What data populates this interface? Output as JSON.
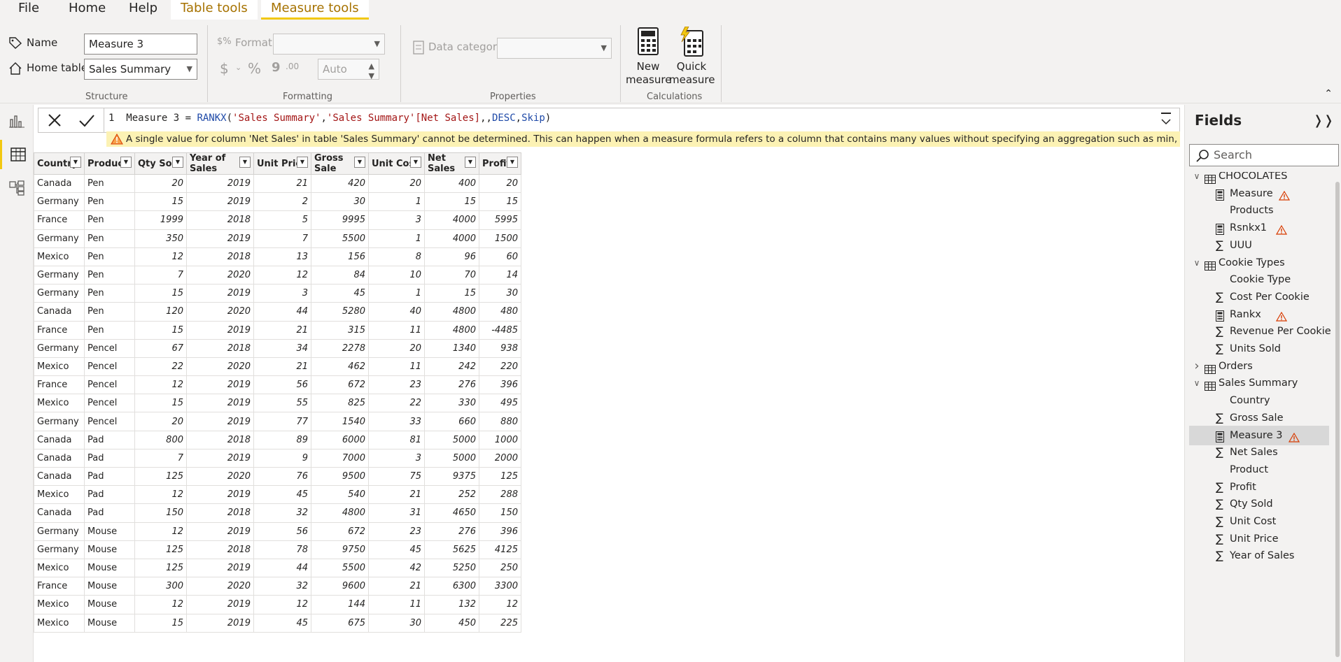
{
  "menu": {
    "file": "File",
    "home": "Home",
    "help": "Help",
    "table_tools": "Table tools",
    "measure_tools": "Measure tools"
  },
  "structure": {
    "group_label": "Structure",
    "name_label": "Name",
    "name_value": "Measure 3",
    "home_table_label": "Home table",
    "home_table_value": "Sales Summary"
  },
  "formatting": {
    "group_label": "Formatting",
    "format_label": "Format",
    "format_value": "",
    "auto_value": "Auto",
    "comma_symbol": "9",
    "decimal_symbol": ".00"
  },
  "properties": {
    "group_label": "Properties",
    "data_category_label": "Data category",
    "data_category_value": ""
  },
  "calculations": {
    "group_label": "Calculations",
    "new_measure": "New measure",
    "quick_measure": "Quick measure"
  },
  "formula": {
    "line_no": "1",
    "lead": "Measure 3 = ",
    "fn": "RANKX",
    "open": "(",
    "arg1": "'Sales Summary'",
    "comma1": ",",
    "arg2": "'Sales Summary'[Net Sales]",
    "commas": ",,",
    "kw1": "DESC",
    "comma2": ",",
    "kw2": "Skip",
    "close": ")",
    "error": "A single value for column 'Net Sales' in table 'Sales Summary' cannot be determined. This can happen when a measure formula refers to a column that contains many values without specifying an aggregation such as min, max, count, or sum to get a single result."
  },
  "table": {
    "columns": [
      "Country",
      "Product",
      "Qty Sold",
      "Year of Sales",
      "Unit Price",
      "Gross Sale",
      "Unit Cost",
      "Net Sales",
      "Profit"
    ],
    "rows": [
      [
        "Canada",
        "Pen",
        "20",
        "2019",
        "21",
        "420",
        "20",
        "400",
        "20"
      ],
      [
        "Germany",
        "Pen",
        "15",
        "2019",
        "2",
        "30",
        "1",
        "15",
        "15"
      ],
      [
        "France",
        "Pen",
        "1999",
        "2018",
        "5",
        "9995",
        "3",
        "4000",
        "5995"
      ],
      [
        "Germany",
        "Pen",
        "350",
        "2019",
        "7",
        "5500",
        "1",
        "4000",
        "1500"
      ],
      [
        "Mexico",
        "Pen",
        "12",
        "2018",
        "13",
        "156",
        "8",
        "96",
        "60"
      ],
      [
        "Germany",
        "Pen",
        "7",
        "2020",
        "12",
        "84",
        "10",
        "70",
        "14"
      ],
      [
        "Germany",
        "Pen",
        "15",
        "2019",
        "3",
        "45",
        "1",
        "15",
        "30"
      ],
      [
        "Canada",
        "Pen",
        "120",
        "2020",
        "44",
        "5280",
        "40",
        "4800",
        "480"
      ],
      [
        "France",
        "Pen",
        "15",
        "2019",
        "21",
        "315",
        "11",
        "4800",
        "-4485"
      ],
      [
        "Germany",
        "Pencel",
        "67",
        "2018",
        "34",
        "2278",
        "20",
        "1340",
        "938"
      ],
      [
        "Mexico",
        "Pencel",
        "22",
        "2020",
        "21",
        "462",
        "11",
        "242",
        "220"
      ],
      [
        "France",
        "Pencel",
        "12",
        "2019",
        "56",
        "672",
        "23",
        "276",
        "396"
      ],
      [
        "Mexico",
        "Pencel",
        "15",
        "2019",
        "55",
        "825",
        "22",
        "330",
        "495"
      ],
      [
        "Germany",
        "Pencel",
        "20",
        "2019",
        "77",
        "1540",
        "33",
        "660",
        "880"
      ],
      [
        "Canada",
        "Pad",
        "800",
        "2018",
        "89",
        "6000",
        "81",
        "5000",
        "1000"
      ],
      [
        "Canada",
        "Pad",
        "7",
        "2019",
        "9",
        "7000",
        "3",
        "5000",
        "2000"
      ],
      [
        "Canada",
        "Pad",
        "125",
        "2020",
        "76",
        "9500",
        "75",
        "9375",
        "125"
      ],
      [
        "Mexico",
        "Pad",
        "12",
        "2019",
        "45",
        "540",
        "21",
        "252",
        "288"
      ],
      [
        "Canada",
        "Pad",
        "150",
        "2018",
        "32",
        "4800",
        "31",
        "4650",
        "150"
      ],
      [
        "Germany",
        "Mouse",
        "12",
        "2019",
        "56",
        "672",
        "23",
        "276",
        "396"
      ],
      [
        "Germany",
        "Mouse",
        "125",
        "2018",
        "78",
        "9750",
        "45",
        "5625",
        "4125"
      ],
      [
        "Mexico",
        "Mouse",
        "125",
        "2019",
        "44",
        "5500",
        "42",
        "5250",
        "250"
      ],
      [
        "France",
        "Mouse",
        "300",
        "2020",
        "32",
        "9600",
        "21",
        "6300",
        "3300"
      ],
      [
        "Mexico",
        "Mouse",
        "12",
        "2019",
        "12",
        "144",
        "11",
        "132",
        "12"
      ],
      [
        "Mexico",
        "Mouse",
        "15",
        "2019",
        "45",
        "675",
        "30",
        "450",
        "225"
      ]
    ]
  },
  "fields": {
    "title": "Fields",
    "search_placeholder": "Search",
    "items": [
      {
        "kind": "table",
        "label": "CHOCOLATES",
        "expanded": true
      },
      {
        "kind": "measure",
        "label": "Measure",
        "warn": true
      },
      {
        "kind": "column",
        "label": "Products"
      },
      {
        "kind": "measure",
        "label": "Rsnkx1",
        "warn": true
      },
      {
        "kind": "sum",
        "label": "UUU"
      },
      {
        "kind": "table",
        "label": "Cookie Types",
        "expanded": true
      },
      {
        "kind": "column",
        "label": "Cookie Type"
      },
      {
        "kind": "sum",
        "label": "Cost Per Cookie"
      },
      {
        "kind": "measure",
        "label": "Rankx",
        "warn": true
      },
      {
        "kind": "sum",
        "label": "Revenue Per Cookie"
      },
      {
        "kind": "sum",
        "label": "Units Sold"
      },
      {
        "kind": "table",
        "label": "Orders",
        "expanded": false
      },
      {
        "kind": "table",
        "label": "Sales Summary",
        "expanded": true
      },
      {
        "kind": "column",
        "label": "Country"
      },
      {
        "kind": "sum",
        "label": "Gross Sale"
      },
      {
        "kind": "measure",
        "label": "Measure 3",
        "warn": true,
        "selected": true
      },
      {
        "kind": "sum",
        "label": "Net Sales"
      },
      {
        "kind": "column",
        "label": "Product"
      },
      {
        "kind": "sum",
        "label": "Profit"
      },
      {
        "kind": "sum",
        "label": "Qty Sold"
      },
      {
        "kind": "sum",
        "label": "Unit Cost"
      },
      {
        "kind": "sum",
        "label": "Unit Price"
      },
      {
        "kind": "sum",
        "label": "Year of Sales"
      }
    ]
  },
  "colors": {
    "accent": "#f2c811",
    "context_tab": "#a67200",
    "warning_bar": "#fcf2b4",
    "warning_icon": "#d83b01"
  }
}
